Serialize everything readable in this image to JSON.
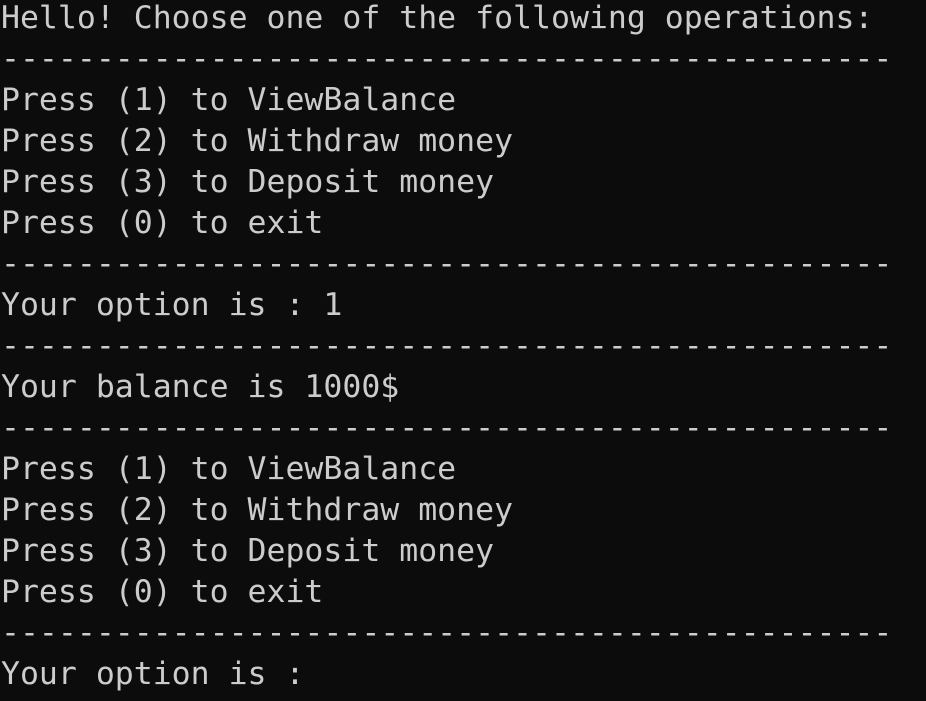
{
  "console": {
    "lines": [
      "Hello! Choose one of the following operations:",
      "-----------------------------------------------",
      "Press (1) to ViewBalance",
      "Press (2) to Withdraw money",
      "Press (3) to Deposit money",
      "Press (0) to exit",
      "-----------------------------------------------",
      "Your option is : 1",
      "-----------------------------------------------",
      "Your balance is 1000$",
      "-----------------------------------------------",
      "Press (1) to ViewBalance",
      "Press (2) to Withdraw money",
      "Press (3) to Deposit money",
      "Press (0) to exit",
      "-----------------------------------------------",
      "Your option is : "
    ]
  },
  "colors": {
    "background": "#0c0c0c",
    "text": "#cccccc"
  }
}
